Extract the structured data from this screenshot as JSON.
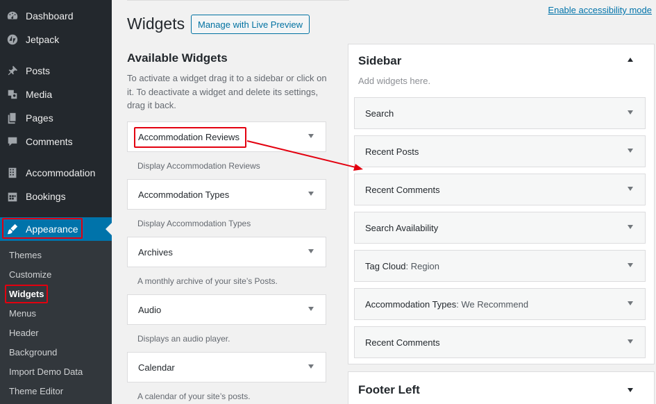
{
  "admin_menu": {
    "items": [
      {
        "label": "Dashboard",
        "icon": "dashboard-icon"
      },
      {
        "label": "Jetpack",
        "icon": "jetpack-icon"
      },
      {
        "label": "Posts",
        "icon": "pin-icon"
      },
      {
        "label": "Media",
        "icon": "media-icon"
      },
      {
        "label": "Pages",
        "icon": "pages-icon"
      },
      {
        "label": "Comments",
        "icon": "comment-icon"
      },
      {
        "label": "Accommodation",
        "icon": "building-icon"
      },
      {
        "label": "Bookings",
        "icon": "calendar-icon"
      }
    ],
    "current": {
      "label": "Appearance",
      "icon": "paintbrush-icon"
    },
    "submenu": [
      "Themes",
      "Customize",
      "Widgets",
      "Menus",
      "Header",
      "Background",
      "Import Demo Data",
      "Theme Editor"
    ],
    "current_submenu": "Widgets"
  },
  "header": {
    "title": "Widgets",
    "live_preview_button": "Manage with Live Preview",
    "accessibility_link": "Enable accessibility mode"
  },
  "available": {
    "title": "Available Widgets",
    "description": "To activate a widget drag it to a sidebar or click on it. To deactivate a widget and delete its settings, drag it back.",
    "widgets": [
      {
        "name": "Accommodation Reviews",
        "description": "Display Accommodation Reviews"
      },
      {
        "name": "Accommodation Types",
        "description": "Display Accommodation Types"
      },
      {
        "name": "Archives",
        "description": "A monthly archive of your site’s Posts."
      },
      {
        "name": "Audio",
        "description": "Displays an audio player."
      },
      {
        "name": "Calendar",
        "description": "A calendar of your site’s posts."
      }
    ]
  },
  "sidebar_area": {
    "title": "Sidebar",
    "description": "Add widgets here.",
    "widgets": [
      {
        "name": "Search",
        "subtitle": ""
      },
      {
        "name": "Recent Posts",
        "subtitle": ""
      },
      {
        "name": "Recent Comments",
        "subtitle": ""
      },
      {
        "name": "Search Availability",
        "subtitle": ""
      },
      {
        "name": "Tag Cloud",
        "subtitle": ": Region"
      },
      {
        "name": "Accommodation Types",
        "subtitle": ": We Recommend"
      },
      {
        "name": "Recent Comments",
        "subtitle": ""
      }
    ]
  },
  "footer_area": {
    "title": "Footer Left"
  },
  "colors": {
    "accent": "#0073aa",
    "annotation": "#e3000f",
    "admin_bg": "#23282d"
  }
}
